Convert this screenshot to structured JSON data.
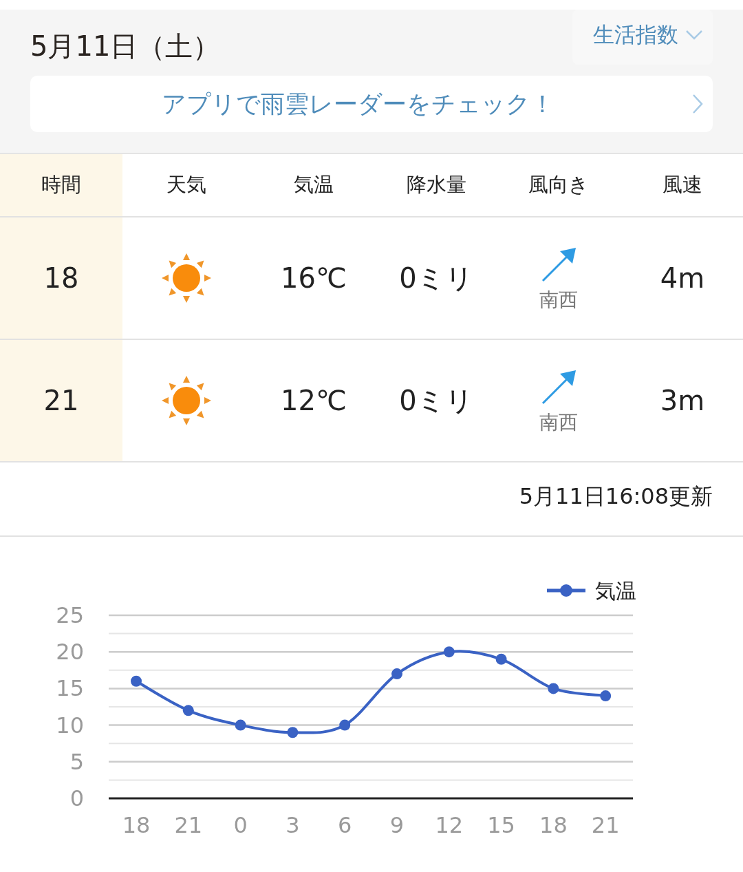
{
  "header": {
    "date": "5月11日（土）",
    "index_button": "生活指数"
  },
  "banner": {
    "text": "アプリで雨雲レーダーをチェック！"
  },
  "table": {
    "columns": [
      "時間",
      "天気",
      "気温",
      "降水量",
      "風向き",
      "風速"
    ],
    "rows": [
      {
        "time": "18",
        "temperature": "16℃",
        "precipitation": "0ミリ",
        "wind_direction": "南西",
        "wind_speed": "4m"
      },
      {
        "time": "21",
        "temperature": "12℃",
        "precipitation": "0ミリ",
        "wind_direction": "南西",
        "wind_speed": "3m"
      }
    ]
  },
  "updated": "5月11日16:08更新",
  "chart": {
    "chart_data": {
      "type": "line",
      "categories": [
        "18",
        "21",
        "0",
        "3",
        "6",
        "9",
        "12",
        "15",
        "18",
        "21"
      ],
      "series": [
        {
          "name": "気温",
          "color": "#3a62c4",
          "marker": "circle",
          "values": [
            16,
            12,
            10,
            9,
            10,
            17,
            20,
            19,
            15,
            14
          ]
        }
      ],
      "grid": true,
      "ylim": [
        0,
        25
      ],
      "yticks": [
        0,
        5,
        10,
        15,
        20,
        25
      ]
    }
  }
}
